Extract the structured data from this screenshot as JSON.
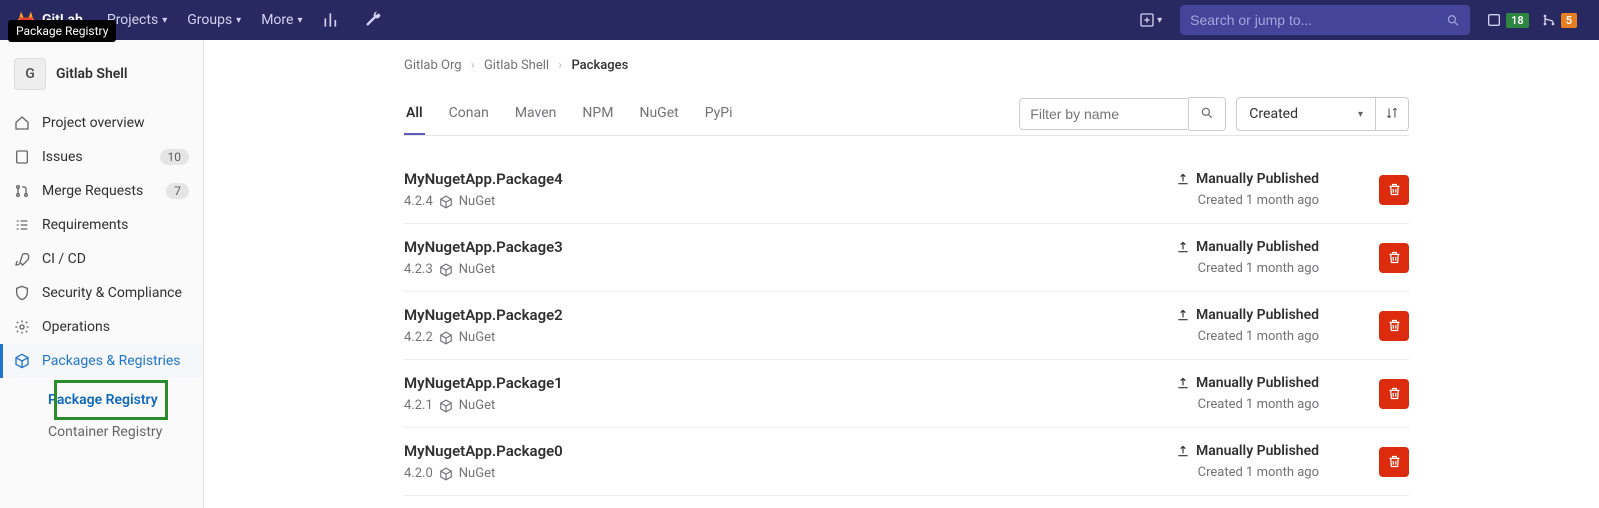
{
  "tooltip": "Package Registry",
  "header": {
    "brand": "GitLab",
    "nav": [
      {
        "label": "Projects"
      },
      {
        "label": "Groups"
      },
      {
        "label": "More"
      }
    ],
    "search_placeholder": "Search or jump to...",
    "todos_count": "18",
    "mr_count": "5"
  },
  "sidebar": {
    "project_initial": "G",
    "project_name": "Gitlab Shell",
    "items": [
      {
        "label": "Project overview"
      },
      {
        "label": "Issues",
        "badge": "10"
      },
      {
        "label": "Merge Requests",
        "badge": "7"
      },
      {
        "label": "Requirements"
      },
      {
        "label": "CI / CD"
      },
      {
        "label": "Security & Compliance"
      },
      {
        "label": "Operations"
      },
      {
        "label": "Packages & Registries"
      }
    ],
    "sub": [
      {
        "label": "Package Registry"
      },
      {
        "label": "Container Registry"
      }
    ]
  },
  "breadcrumb": {
    "org": "Gitlab Org",
    "project": "Gitlab Shell",
    "page": "Packages"
  },
  "tabs": [
    {
      "label": "All"
    },
    {
      "label": "Conan"
    },
    {
      "label": "Maven"
    },
    {
      "label": "NPM"
    },
    {
      "label": "NuGet"
    },
    {
      "label": "PyPi"
    }
  ],
  "filter_placeholder": "Filter by name",
  "sort_label": "Created",
  "packages": [
    {
      "name": "MyNugetApp.Package4",
      "version": "4.2.4",
      "type": "NuGet",
      "publish": "Manually Published",
      "time": "Created 1 month ago"
    },
    {
      "name": "MyNugetApp.Package3",
      "version": "4.2.3",
      "type": "NuGet",
      "publish": "Manually Published",
      "time": "Created 1 month ago"
    },
    {
      "name": "MyNugetApp.Package2",
      "version": "4.2.2",
      "type": "NuGet",
      "publish": "Manually Published",
      "time": "Created 1 month ago"
    },
    {
      "name": "MyNugetApp.Package1",
      "version": "4.2.1",
      "type": "NuGet",
      "publish": "Manually Published",
      "time": "Created 1 month ago"
    },
    {
      "name": "MyNugetApp.Package0",
      "version": "4.2.0",
      "type": "NuGet",
      "publish": "Manually Published",
      "time": "Created 1 month ago"
    }
  ]
}
